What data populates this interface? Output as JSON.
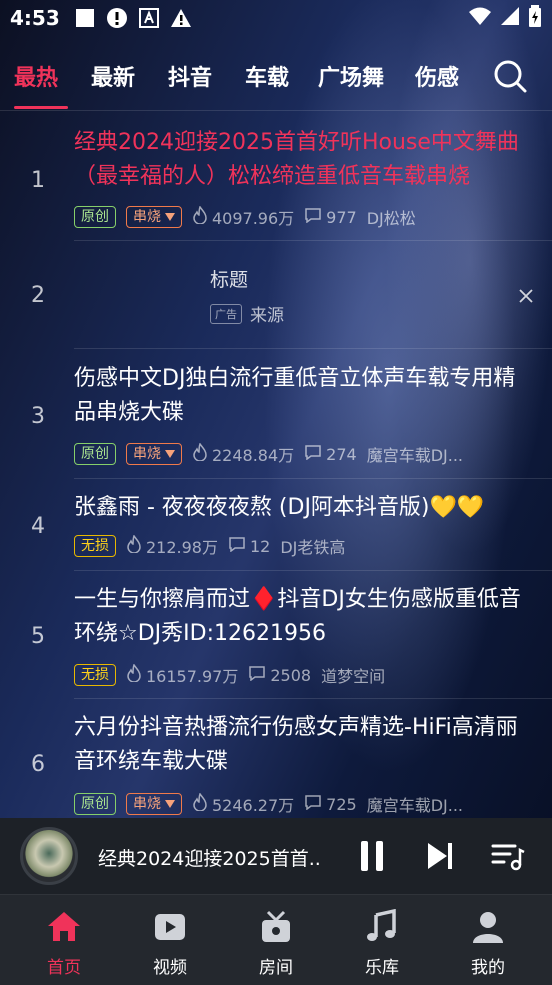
{
  "status_bar": {
    "time": "4:53"
  },
  "tabs": [
    {
      "label": "最热"
    },
    {
      "label": "最新"
    },
    {
      "label": "抖音"
    },
    {
      "label": "车载"
    },
    {
      "label": "广场舞"
    },
    {
      "label": "伤感"
    }
  ],
  "rows": [
    {
      "rank": "1",
      "title": "经典2024迎接2025首首好听House中文舞曲（最幸福的人）松松缔造重低音车载串烧",
      "badge1": "原创",
      "badge2": "串烧",
      "plays": "4097.96万",
      "comments": "977",
      "author": "DJ松松"
    },
    {
      "rank": "2",
      "ad_title": "标题",
      "ad_tag": "广告",
      "ad_source": "来源"
    },
    {
      "rank": "3",
      "title": "伤感中文DJ独白流行重低音立体声车载专用精品串烧大碟",
      "badge1": "原创",
      "badge2": "串烧",
      "plays": "2248.84万",
      "comments": "274",
      "author": "魔宫车载DJ..."
    },
    {
      "rank": "4",
      "title": "张鑫雨 - 夜夜夜夜熬 (DJ阿本抖音版)💛💛",
      "badge1": "无损",
      "plays": "212.98万",
      "comments": "12",
      "author": "DJ老铁高"
    },
    {
      "rank": "5",
      "title": "一生与你擦肩而过♦️抖音DJ女生伤感版重低音环绕☆DJ秀ID:12621956",
      "badge1": "无损",
      "plays": "16157.97万",
      "comments": "2508",
      "author": "道梦空间"
    },
    {
      "rank": "6",
      "title": "六月份抖音热播流行伤感女声精选-HiFi高清丽音环绕车载大碟",
      "badge1": "原创",
      "badge2": "串烧",
      "plays": "5246.27万",
      "comments": "725",
      "author": "魔宫车载DJ..."
    }
  ],
  "player": {
    "title": "经典2024迎接2025首首.."
  },
  "bottom_nav": [
    {
      "label": "首页",
      "icon": "home-icon"
    },
    {
      "label": "视频",
      "icon": "video-icon"
    },
    {
      "label": "房间",
      "icon": "room-icon"
    },
    {
      "label": "乐库",
      "icon": "music-icon"
    },
    {
      "label": "我的",
      "icon": "profile-icon"
    }
  ],
  "colors": {
    "accent": "#f0335a",
    "player_bg": "#1d2127",
    "nav_bg": "#24282e"
  }
}
